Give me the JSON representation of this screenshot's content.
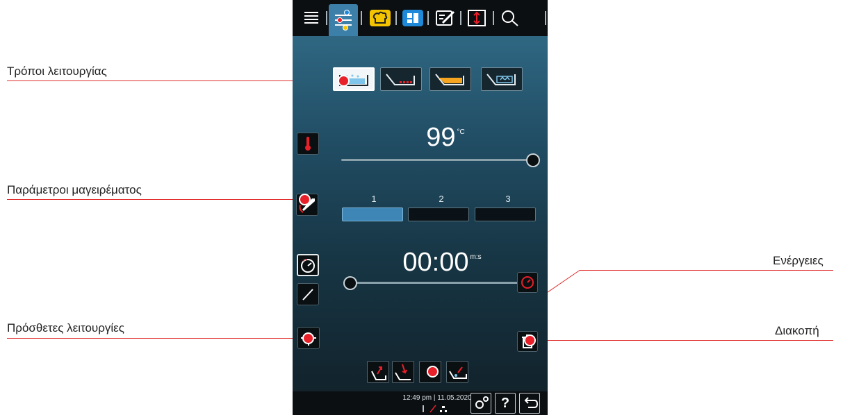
{
  "callouts": {
    "modes": "Τρόποι λειτουργίας",
    "params": "Παράμετροι μαγειρέματος",
    "extra": "Πρόσθετες λειτουργίες",
    "actions": "Ενέργειες",
    "stop": "Διακοπή"
  },
  "temperature": {
    "value": "99",
    "unit": "°C",
    "slider_fraction": 1.0
  },
  "stages": {
    "labels": [
      "1",
      "2",
      "3"
    ],
    "active_index": 0
  },
  "timer": {
    "value": "00:00",
    "unit": "m:s",
    "slider_fraction": 0.0
  },
  "statusbar": {
    "time": "12:49 pm",
    "separator": "|",
    "date": "11.05.2020",
    "help_label": "?"
  },
  "tabs": [
    "menu-icon",
    "manual-cooking-icon",
    "chef-hat-icon",
    "programming-icon",
    "edit-icon",
    "expand-icon",
    "search-icon"
  ],
  "colors": {
    "accent_red": "#e8202a",
    "active_blue": "#3d86b6",
    "tab_yellow": "#f5c400",
    "tab_blue": "#1e88d9"
  }
}
